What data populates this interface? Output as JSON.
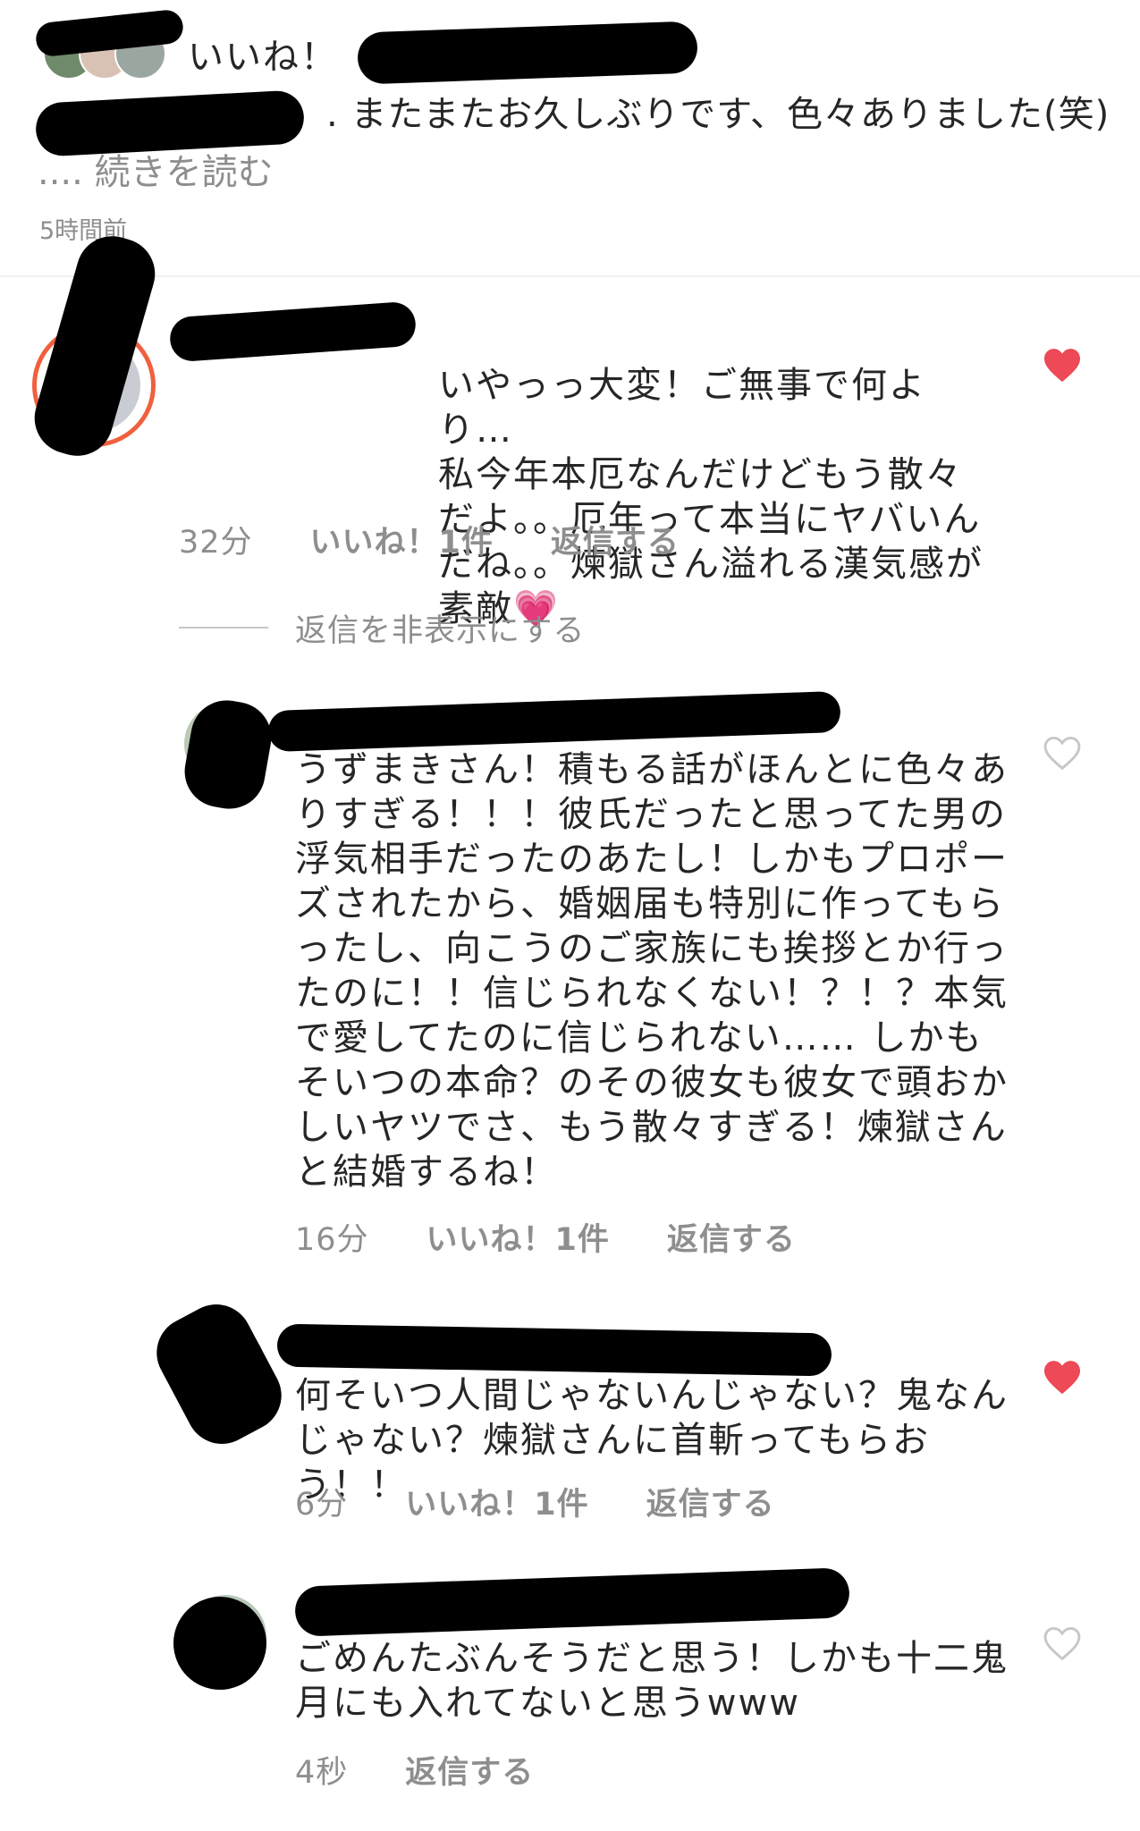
{
  "post": {
    "likes_label": "いいね！",
    "caption_user": "",
    "caption_text": ". またまたお久しぶりです、色々ありました(笑)",
    "read_more": ".... 続きを読む",
    "time": "5時間前"
  },
  "comments": [
    {
      "user": "",
      "text": "いやっっ大変！ご無事で何より…\n私今年本厄なんだけどもう散々だよ。。厄年って本当にヤバいんだね。。煉獄さん溢れる漢気感が素敵💗",
      "time": "32分",
      "likes": "いいね！1件",
      "reply": "返信する",
      "liked": true
    }
  ],
  "hide_replies": "返信を非表示にする",
  "replies": [
    {
      "mention": "",
      "text": "うずまきさん！積もる話がほんとに色々ありすぎる！！！彼氏だったと思ってた男の浮気相手だったのあたし！しかもプロポーズされたから、婚姻届も特別に作ってもらったし、向こうのご家族にも挨拶とか行ったのに！！信じられなくない！？！？本気で愛してたのに信じられない…… しかもそいつの本命？のその彼女も彼女で頭おかしいヤツでさ、もう散々すぎる！煉獄さんと結婚するね！",
      "time": "16分",
      "likes": "いいね！1件",
      "reply": "返信する",
      "liked": false
    },
    {
      "mention": "",
      "text": "何そいつ人間じゃないんじゃない？鬼なんじゃない？煉獄さんに首斬ってもらおう！！",
      "time": "6分",
      "likes": "いいね！1件",
      "reply": "返信する",
      "liked": true
    },
    {
      "mention": "",
      "text": "ごめんたぶんそうだと思う！しかも十二鬼月にも入れてないと思うwww",
      "time": "4秒",
      "likes": "",
      "reply": "返信する",
      "liked": false
    }
  ],
  "colors": {
    "heart_liked": "#ed4956",
    "heart_outline": "#c7c7c7",
    "meta_gray": "#8e8e8e",
    "story_ring": "#f0603e"
  },
  "icons": {
    "liked": "heart-filled-icon",
    "unliked": "heart-outline-icon"
  }
}
